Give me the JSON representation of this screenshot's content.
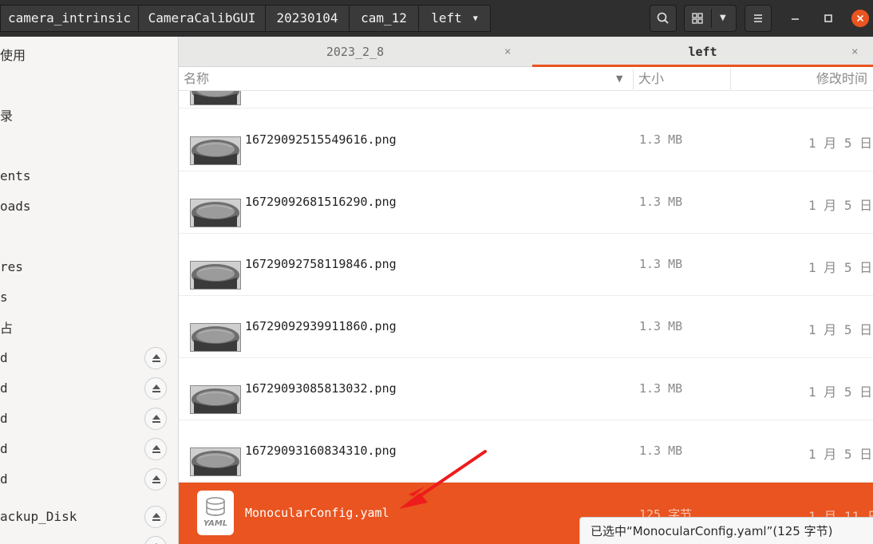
{
  "header": {
    "breadcrumbs": [
      "camera_intrinsic",
      "CameraCalibGUI",
      "20230104",
      "cam_12",
      "left"
    ],
    "current_dropdown_icon": "chevron-down-icon",
    "buttons": {
      "search": "search-icon",
      "view": "grid-view-icon",
      "view_options": "chevron-down-icon",
      "menu": "hamburger-menu-icon",
      "minimize": "minimize-icon",
      "maximize": "maximize-icon",
      "close": "close-icon"
    },
    "close_color": "#e95420"
  },
  "sidebar": {
    "items": [
      {
        "label": "使用",
        "eject": false
      },
      {
        "label": "录",
        "eject": false
      },
      {
        "label": "ents",
        "eject": false
      },
      {
        "label": "oads",
        "eject": false
      },
      {
        "label": "res",
        "eject": false
      },
      {
        "label": "s",
        "eject": false
      },
      {
        "label": "占",
        "eject": false
      },
      {
        "label": "d",
        "eject": true
      },
      {
        "label": "d",
        "eject": true
      },
      {
        "label": "d",
        "eject": true
      },
      {
        "label": "d",
        "eject": true
      },
      {
        "label": "d",
        "eject": true
      },
      {
        "label": "ackup_Disk",
        "eject": true
      }
    ]
  },
  "tabs": [
    {
      "label": "2023_2_8",
      "active": false
    },
    {
      "label": "left",
      "active": true
    }
  ],
  "tab_close_glyph": "×",
  "accent_color": "#e95420",
  "columns": {
    "name": "名称",
    "size": "大小",
    "modified": "修改时间"
  },
  "files": [
    {
      "name": "16729092515549616.png",
      "size": "1.3 MB",
      "date": "1 月 5 日"
    },
    {
      "name": "16729092681516290.png",
      "size": "1.3 MB",
      "date": "1 月 5 日"
    },
    {
      "name": "16729092758119846.png",
      "size": "1.3 MB",
      "date": "1 月 5 日"
    },
    {
      "name": "16729092939911860.png",
      "size": "1.3 MB",
      "date": "1 月 5 日"
    },
    {
      "name": "16729093085813032.png",
      "size": "1.3 MB",
      "date": "1 月 5 日"
    },
    {
      "name": "16729093160834310.png",
      "size": "1.3 MB",
      "date": "1 月 5 日"
    }
  ],
  "selected_file": {
    "name": "MonocularConfig.yaml",
    "size": "125 字节",
    "date": "1 月 11 日",
    "icon": "yaml-file-icon",
    "icon_text": "YAML"
  },
  "status_text": "已选中“MonocularConfig.yaml”(125 字节)",
  "annotation": {
    "arrow_color": "#ee1c1c"
  }
}
